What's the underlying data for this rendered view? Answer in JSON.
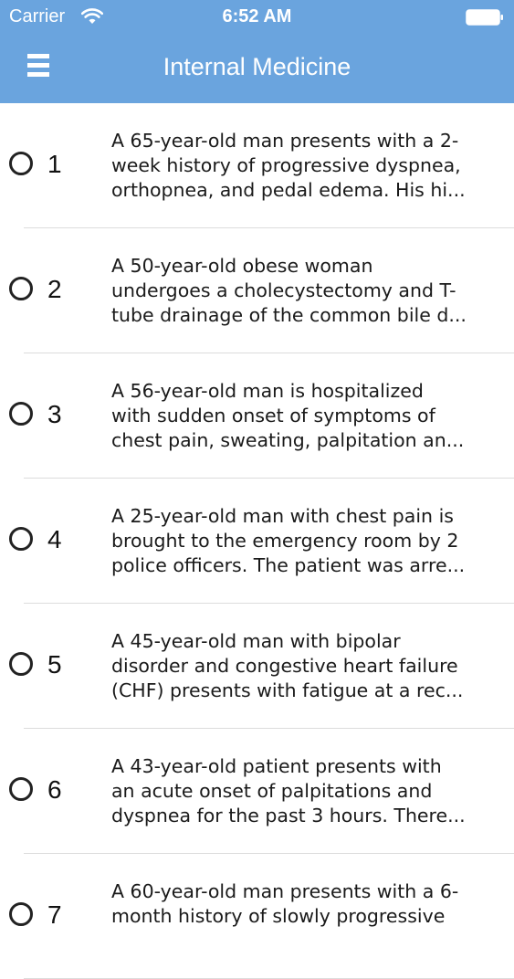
{
  "status_bar": {
    "carrier": "Carrier",
    "time": "6:52 AM",
    "wifi_icon": "wifi-icon",
    "battery_icon": "battery-full-icon"
  },
  "nav": {
    "menu_icon": "hamburger-menu-icon",
    "title": "Internal Medicine",
    "color": "#6aa4de"
  },
  "questions": [
    {
      "number": "1",
      "lines": [
        "A 65-year-old man presents with a 2-",
        "week history of progressive dyspnea,",
        "orthopnea, and pedal edema. His hi..."
      ]
    },
    {
      "number": "2",
      "lines": [
        "A 50-year-old obese woman",
        "undergoes a cholecystectomy and T-",
        "tube drainage of the common bile d..."
      ]
    },
    {
      "number": "3",
      "lines": [
        "A 56-year-old man is hospitalized",
        "with sudden onset of symptoms of",
        "chest pain, sweating, palpitation an..."
      ]
    },
    {
      "number": "4",
      "lines": [
        "A 25-year-old man with chest pain is",
        "brought to the emergency room by 2",
        "police officers. The patient was arre..."
      ]
    },
    {
      "number": "5",
      "lines": [
        "A 45-year-old man with bipolar",
        "disorder and congestive heart failure",
        "(CHF) presents with fatigue at a rec..."
      ]
    },
    {
      "number": "6",
      "lines": [
        "A 43-year-old patient presents with",
        "an acute onset of palpitations and",
        "dyspnea for the past 3 hours. There..."
      ]
    },
    {
      "number": "7",
      "lines": [
        "A 60-year-old man presents with a 6-",
        "month history of slowly progressive"
      ]
    }
  ]
}
